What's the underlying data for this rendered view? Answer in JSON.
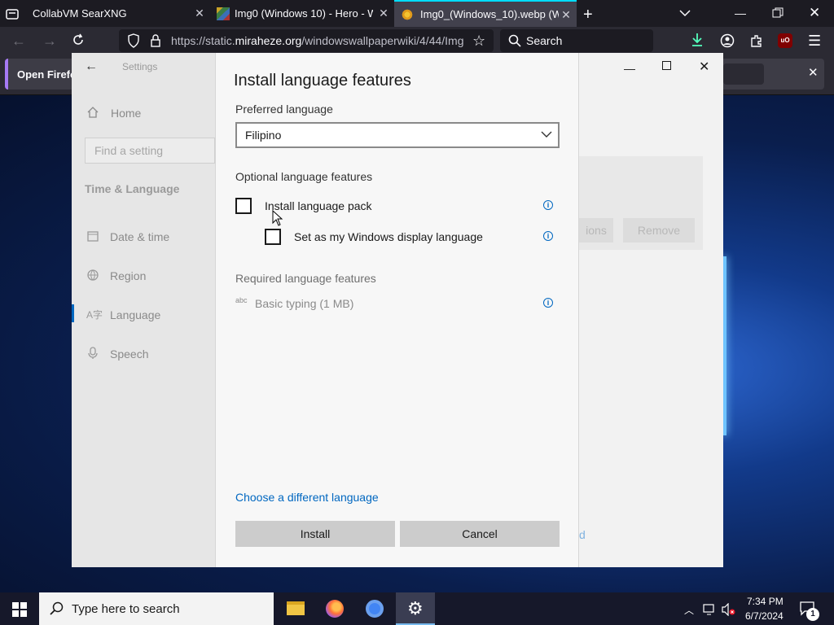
{
  "browser": {
    "tabs": [
      {
        "title": "CollabVM SearXNG"
      },
      {
        "title": "Img0 (Windows 10) - Hero - Wi"
      },
      {
        "title": "Img0_(Windows_10).webp (WEB"
      }
    ],
    "url_prefix": "https://static.",
    "url_domain": "miraheze.org",
    "url_rest": "/windowswallpaperwiki/4/44/Img",
    "search_label": "Search",
    "notification_text": "Open Firefo",
    "accent_color": "#00ddff"
  },
  "settings": {
    "header": "Settings",
    "home": "Home",
    "find_placeholder": "Find a setting",
    "section": "Time & Language",
    "nav": [
      {
        "label": "Date & time"
      },
      {
        "label": "Region"
      },
      {
        "label": "Language"
      },
      {
        "label": "Speech"
      }
    ],
    "bg_options_btn": "ions",
    "bg_remove_btn": "Remove",
    "bg_link_frag": "d"
  },
  "dialog": {
    "title": "Install language features",
    "preferred_label": "Preferred language",
    "preferred_value": "Filipino",
    "optional_label": "Optional language features",
    "opt_pack": "Install language pack",
    "opt_display": "Set as my Windows display language",
    "required_label": "Required language features",
    "basic_typing_icon": "abc",
    "basic_typing": "Basic typing (1 MB)",
    "choose_link": "Choose a different language",
    "install_btn": "Install",
    "cancel_btn": "Cancel",
    "link_color": "#0067c0"
  },
  "taskbar": {
    "search_placeholder": "Type here to search",
    "time": "7:34 PM",
    "date": "6/7/2024",
    "notif_count": "1"
  }
}
